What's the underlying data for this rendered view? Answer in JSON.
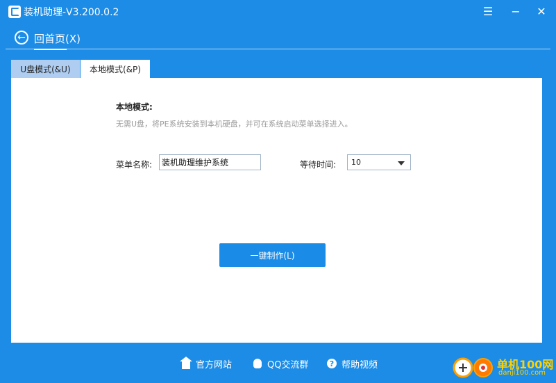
{
  "window": {
    "title": "装机助理-V3.200.0.2",
    "menu_icon": "☰",
    "minimize_icon": "−",
    "close_icon": "✕"
  },
  "nav": {
    "back_label": "回首页(X)",
    "back_icon": "arrow-left-icon"
  },
  "tabs": [
    {
      "label": "U盘模式(&U)",
      "active": false
    },
    {
      "label": "本地模式(&P)",
      "active": true
    }
  ],
  "local_mode": {
    "title": "本地模式:",
    "description": "无需U盘，将PE系统安装到本机硬盘，并可在系统启动菜单选择进入。",
    "menu_name_label": "菜单名称:",
    "menu_name_value": "装机助理维护系统",
    "wait_time_label": "等待时间:",
    "wait_time_value": "10",
    "make_button_label": "一键制作(L)"
  },
  "footer": {
    "links": [
      {
        "label": "官方网站",
        "icon": "home-icon"
      },
      {
        "label": "QQ交流群",
        "icon": "qq-icon"
      },
      {
        "label": "帮助视频",
        "icon": "help-icon"
      }
    ]
  },
  "watermark": {
    "brand": "单机100网",
    "url": "danji100.com"
  },
  "colors": {
    "background": "#1c8ce6",
    "button": "#1a8ce8",
    "inactive_tab": "#aecdf1",
    "watermark": "#ffd200"
  }
}
